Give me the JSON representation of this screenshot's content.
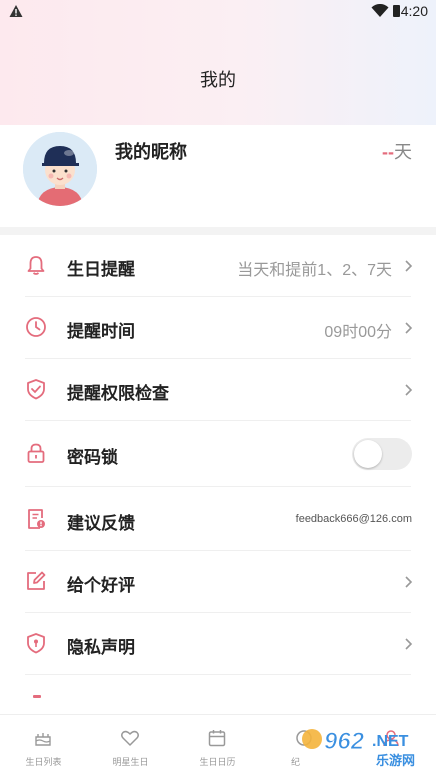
{
  "status_bar": {
    "time": "4:20"
  },
  "header": {
    "title": "我的"
  },
  "profile": {
    "nickname": "我的昵称",
    "days_value": "--",
    "days_unit": "天"
  },
  "menu": [
    {
      "icon": "bell-icon",
      "label": "生日提醒",
      "value": "当天和提前1、2、7天",
      "chevron": true
    },
    {
      "icon": "clock-icon",
      "label": "提醒时间",
      "value": "09时00分",
      "chevron": true
    },
    {
      "icon": "shield-check-icon",
      "label": "提醒权限检查",
      "value": "",
      "chevron": true
    },
    {
      "icon": "lock-icon",
      "label": "密码锁",
      "toggle": false
    },
    {
      "icon": "feedback-icon",
      "label": "建议反馈",
      "value": "feedback666@126.com",
      "chevron": false
    },
    {
      "icon": "edit-icon",
      "label": "给个好评",
      "value": "",
      "chevron": true
    },
    {
      "icon": "privacy-icon",
      "label": "隐私声明",
      "value": "",
      "chevron": true
    }
  ],
  "tabbar": [
    {
      "icon": "birthday-list-icon",
      "label": "生日列表"
    },
    {
      "icon": "heart-icon",
      "label": "明星生日"
    },
    {
      "icon": "calendar-icon",
      "label": "生日日历"
    },
    {
      "icon": "memorial-icon",
      "label": "纪"
    },
    {
      "icon": "profile-icon",
      "label": ""
    }
  ],
  "watermark": {
    "brand": "962",
    "suffix": ".NET",
    "sub": "乐游网"
  },
  "colors": {
    "accent": "#e46c7d",
    "text": "#222222",
    "muted": "#999999"
  }
}
